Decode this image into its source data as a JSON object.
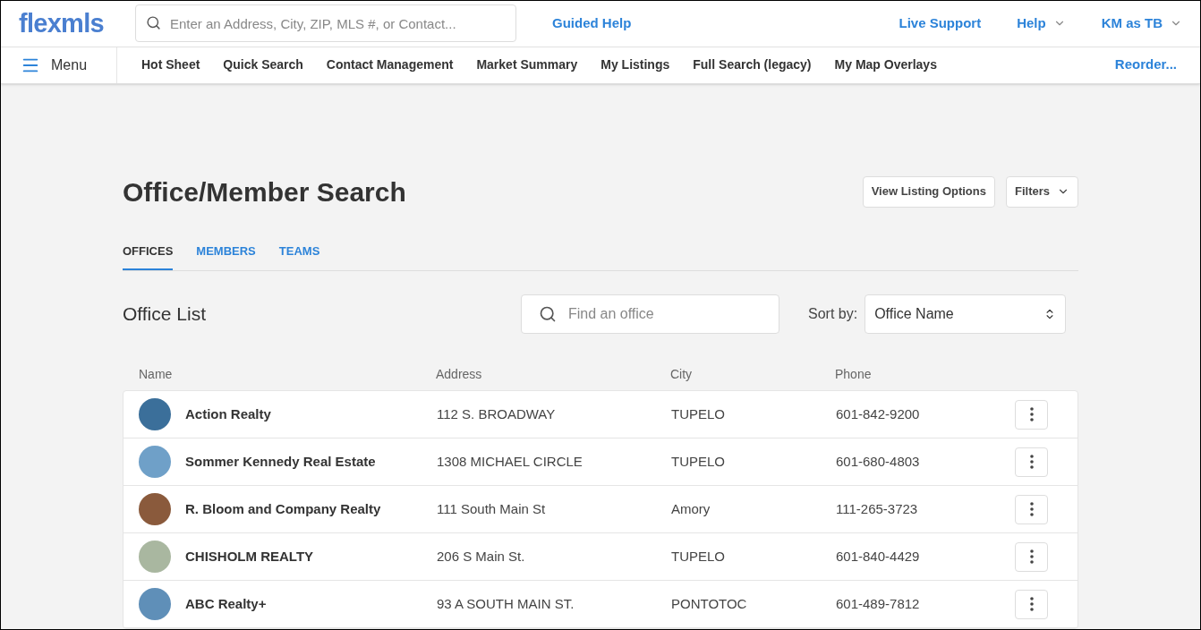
{
  "header": {
    "logo": "flexmls",
    "search": {
      "placeholder": "Enter an Address, City, ZIP, MLS #, or Contact..."
    },
    "guided_help": "Guided Help",
    "links": [
      {
        "label": "Live Support",
        "dropdown": false
      },
      {
        "label": "Help",
        "dropdown": true
      },
      {
        "label": "KM as TB",
        "dropdown": true
      }
    ]
  },
  "nav": {
    "menu": "Menu",
    "items": [
      "Hot Sheet",
      "Quick Search",
      "Contact Management",
      "Market Summary",
      "My Listings",
      "Full Search (legacy)",
      "My Map Overlays"
    ],
    "reorder": "Reorder..."
  },
  "page": {
    "title": "Office/Member Search",
    "buttons": [
      {
        "label": "View Listing Options",
        "dropdown": false
      },
      {
        "label": "Filters",
        "dropdown": true
      }
    ],
    "tabs": [
      {
        "label": "OFFICES",
        "selected": true
      },
      {
        "label": "MEMBERS",
        "selected": false
      },
      {
        "label": "TEAMS",
        "selected": false
      }
    ]
  },
  "office_list": {
    "title": "Office List",
    "search": {
      "placeholder": "Find an office"
    },
    "sort_label": "Sort by:",
    "sort_value": "Office Name",
    "columns": [
      "Name",
      "Address",
      "City",
      "Phone"
    ],
    "rows": [
      {
        "name": "Action Realty",
        "address": "112 S. BROADWAY",
        "city": "TUPELO",
        "phone": "601-842-9200",
        "color": "#3b6f9a"
      },
      {
        "name": "Sommer Kennedy Real Estate",
        "address": "1308 MICHAEL CIRCLE",
        "city": "TUPELO",
        "phone": "601-680-4803",
        "color": "#6fa0c8"
      },
      {
        "name": "R. Bloom and Company Realty",
        "address": "111 South Main St",
        "city": "Amory",
        "phone": "111-265-3723",
        "color": "#8a5a3c"
      },
      {
        "name": "CHISHOLM REALTY",
        "address": "206 S Main St.",
        "city": "TUPELO",
        "phone": "601-840-4429",
        "color": "#a9b7a0"
      },
      {
        "name": "ABC Realty+",
        "address": "93 A SOUTH MAIN ST.",
        "city": "PONTOTOC",
        "phone": "601-489-7812",
        "color": "#5f8fb8"
      }
    ]
  }
}
